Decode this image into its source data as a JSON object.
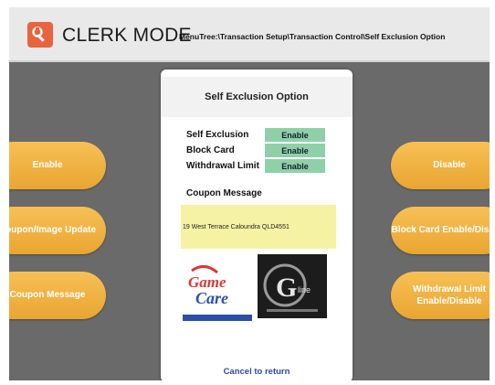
{
  "header": {
    "title": "CLERK MODE",
    "menutree": "MenuTree:\\Transaction Setup\\Transaction Control\\Self Exclusion Option"
  },
  "left_buttons": [
    "Enable",
    "Coupon/Image Update",
    "Coupon Message"
  ],
  "right_buttons": [
    "Disable",
    "Block Card Enable/Disable",
    "Withdrawal Limit Enable/Disable"
  ],
  "panel": {
    "title": "Self Exclusion Option",
    "options": [
      {
        "label": "Self Exclusion",
        "value": "Enable"
      },
      {
        "label": "Block Card",
        "value": "Enable"
      },
      {
        "label": "Withdrawal Limit",
        "value": "Enable"
      }
    ],
    "coupon_label": "Coupon Message",
    "coupon_text": "19 West Terrace Caloundra QLD4551",
    "images": [
      "gamecare-logo",
      "gline-logo"
    ],
    "cancel": "Cancel to return"
  },
  "colors": {
    "accent": "#e9a531",
    "enable_bg": "#8fd0a8",
    "coupon_bg": "#f5f2a4",
    "logo_bg": "#e8643f",
    "cancel": "#2b4aa6"
  }
}
